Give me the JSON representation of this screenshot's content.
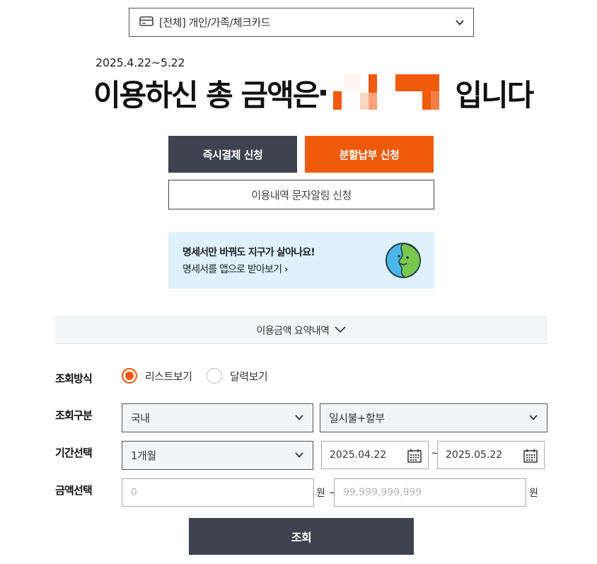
{
  "card_selector": {
    "label": "[전체] 개인/가족/체크카드",
    "icon": "credit-card-icon"
  },
  "summary_header": {
    "period": "2025.4.22~5.22",
    "total_prefix": "이용하신 총 금액은",
    "total_suffix": "입니다"
  },
  "actions": {
    "instant_pay": "즉시결제 신청",
    "installment": "분할납부 신청",
    "sms_alert": "이용내역 문자알림 신청"
  },
  "banner": {
    "line1": "명세서만 바꿔도 지구가 살아나요!",
    "line2": "명세서를 앱으로 받아보기",
    "arrow": "›",
    "icon": "earth-icon",
    "bg_color": "#ddf2fd"
  },
  "usage_summary": {
    "label": "이용금액 요약내역"
  },
  "form": {
    "view_mode": {
      "label": "조회방식",
      "options": [
        {
          "label": "리스트보기",
          "selected": true
        },
        {
          "label": "달력보기",
          "selected": false
        }
      ]
    },
    "category": {
      "label": "조회구분",
      "region_value": "국내",
      "type_value": "일시불+할부"
    },
    "period": {
      "label": "기간선택",
      "range_value": "1개월",
      "start_date": "2025.04.22",
      "separator": "~",
      "end_date": "2025.05.22"
    },
    "amount": {
      "label": "금액선택",
      "min_placeholder": "0",
      "unit_min": "원 ~",
      "max_placeholder": "99,999,999,999",
      "unit_max": "원"
    },
    "submit_label": "조회"
  },
  "colors": {
    "accent": "#f15a0a",
    "dark_button": "#3e434f"
  }
}
